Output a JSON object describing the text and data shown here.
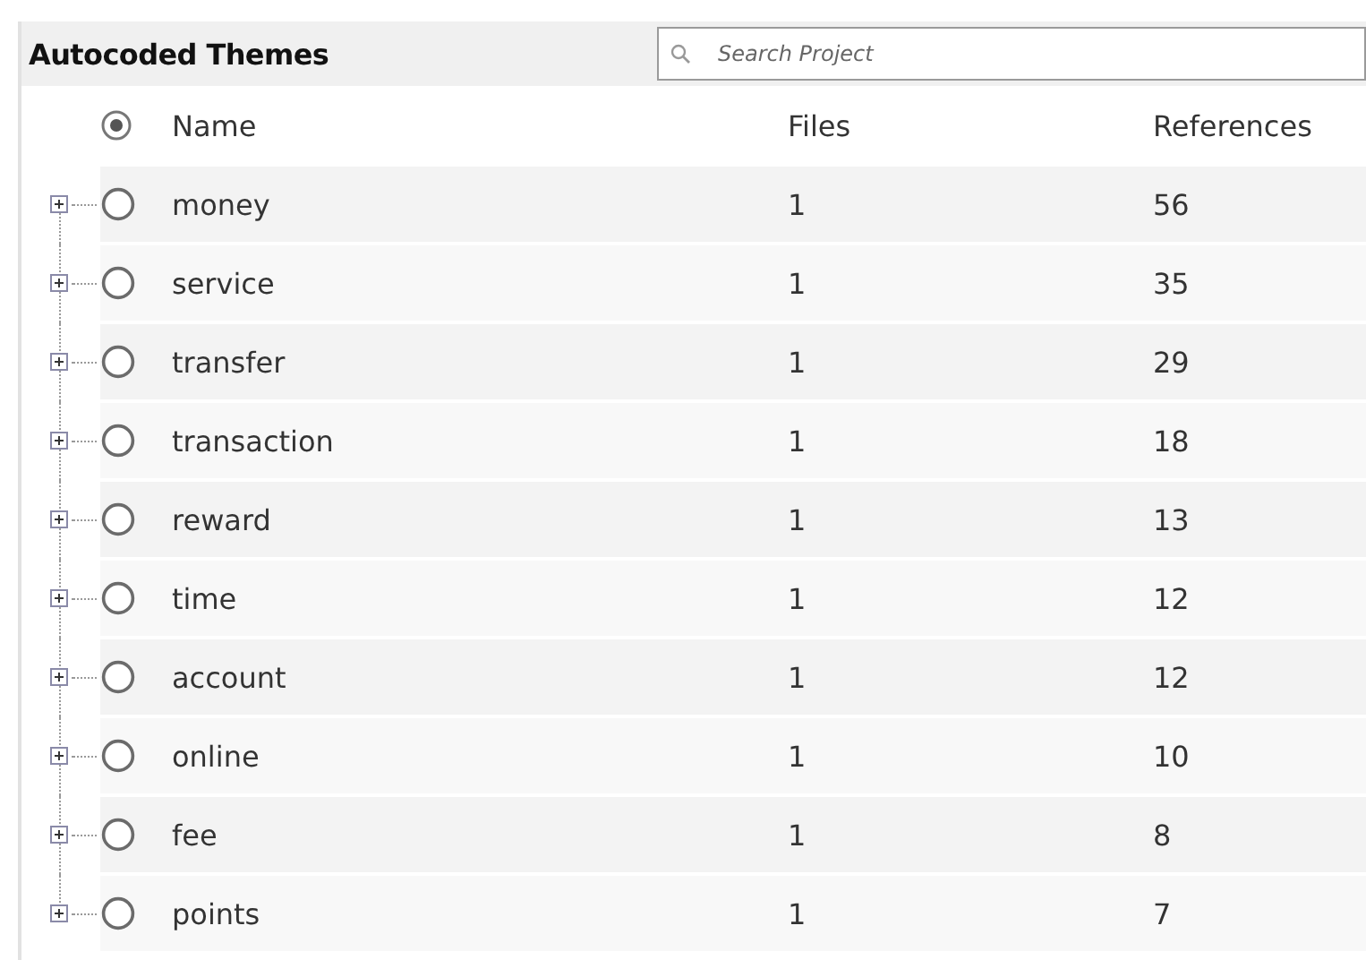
{
  "panel": {
    "title": "Autocoded Themes"
  },
  "search": {
    "placeholder": "Search Project"
  },
  "table": {
    "header_checked": true,
    "columns": [
      "Name",
      "Files",
      "References"
    ],
    "rows": [
      {
        "name": "money",
        "files": "1",
        "references": "56",
        "checked": false,
        "expanded": false
      },
      {
        "name": "service",
        "files": "1",
        "references": "35",
        "checked": false,
        "expanded": false
      },
      {
        "name": "transfer",
        "files": "1",
        "references": "29",
        "checked": false,
        "expanded": false
      },
      {
        "name": "transaction",
        "files": "1",
        "references": "18",
        "checked": false,
        "expanded": false
      },
      {
        "name": "reward",
        "files": "1",
        "references": "13",
        "checked": false,
        "expanded": false
      },
      {
        "name": "time",
        "files": "1",
        "references": "12",
        "checked": false,
        "expanded": false
      },
      {
        "name": "account",
        "files": "1",
        "references": "12",
        "checked": false,
        "expanded": false
      },
      {
        "name": "online",
        "files": "1",
        "references": "10",
        "checked": false,
        "expanded": false
      },
      {
        "name": "fee",
        "files": "1",
        "references": "8",
        "checked": false,
        "expanded": false
      },
      {
        "name": "points",
        "files": "1",
        "references": "7",
        "checked": false,
        "expanded": false
      }
    ]
  }
}
